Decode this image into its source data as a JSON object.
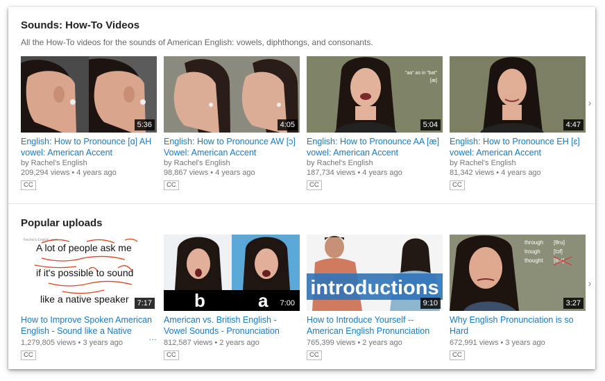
{
  "shelves": [
    {
      "title": "Sounds: How-To Videos",
      "description": "All the How-To videos for the sounds of American English: vowels, diphthongs, and consonants.",
      "videos": [
        {
          "title": "English: How to Pronounce [ɑ] AH vowel: American Accent",
          "channel": "by Rachel's English",
          "views": "209,294 views",
          "age": "4 years ago",
          "duration": "5:36",
          "badge": "CC"
        },
        {
          "title": "English: How to Pronounce AW [ɔ] Vowel: American Accent",
          "channel": "by Rachel's English",
          "views": "98,867 views",
          "age": "4 years ago",
          "duration": "4:05",
          "badge": "CC"
        },
        {
          "title": "English: How to Pronounce AA [æ] vowel: American Accent",
          "channel": "by Rachel's English",
          "views": "187,734 views",
          "age": "4 years ago",
          "duration": "5:04",
          "badge": "CC",
          "overlay": [
            "\"aa\" as in \"bat\"",
            "[æ]"
          ]
        },
        {
          "title": "English: How to Pronounce EH [ɛ] vowel: American Accent",
          "channel": "by Rachel's English",
          "views": "81,342 views",
          "age": "4 years ago",
          "duration": "4:47",
          "badge": "CC"
        }
      ]
    },
    {
      "title": "Popular uploads",
      "videos": [
        {
          "title": "How to Improve Spoken American English - Sound like a Native",
          "views": "1,279,805 views",
          "age": "3 years ago",
          "duration": "7:17",
          "badge": "CC",
          "overlay": [
            "Rachel's English .com",
            "A lot of people ask me",
            "if it's possible to sound",
            "like a native speaker"
          ]
        },
        {
          "title": "American vs. British English - Vowel Sounds - Pronunciation",
          "views": "812,587 views",
          "age": "2 years ago",
          "duration": "7:00",
          "badge": "CC",
          "overlay": [
            "b",
            "a"
          ]
        },
        {
          "title": "How to Introduce Yourself -- American English Pronunciation",
          "views": "765,399 views",
          "age": "2 years ago",
          "duration": "9:10",
          "badge": "CC",
          "overlay": [
            "introductions"
          ]
        },
        {
          "title": "Why English Pronunciation is so Hard",
          "views": "672,991 views",
          "age": "3 years ago",
          "duration": "3:27",
          "badge": "CC",
          "overlay": [
            "through",
            "[θru]",
            "trough",
            "[tɔf]",
            "thought",
            "[θɔt]"
          ]
        }
      ]
    }
  ],
  "ellipsis": "…",
  "icons": {
    "next": "chevron-right-icon"
  },
  "colors": {
    "link": "#167ac6",
    "meta": "#767676"
  }
}
